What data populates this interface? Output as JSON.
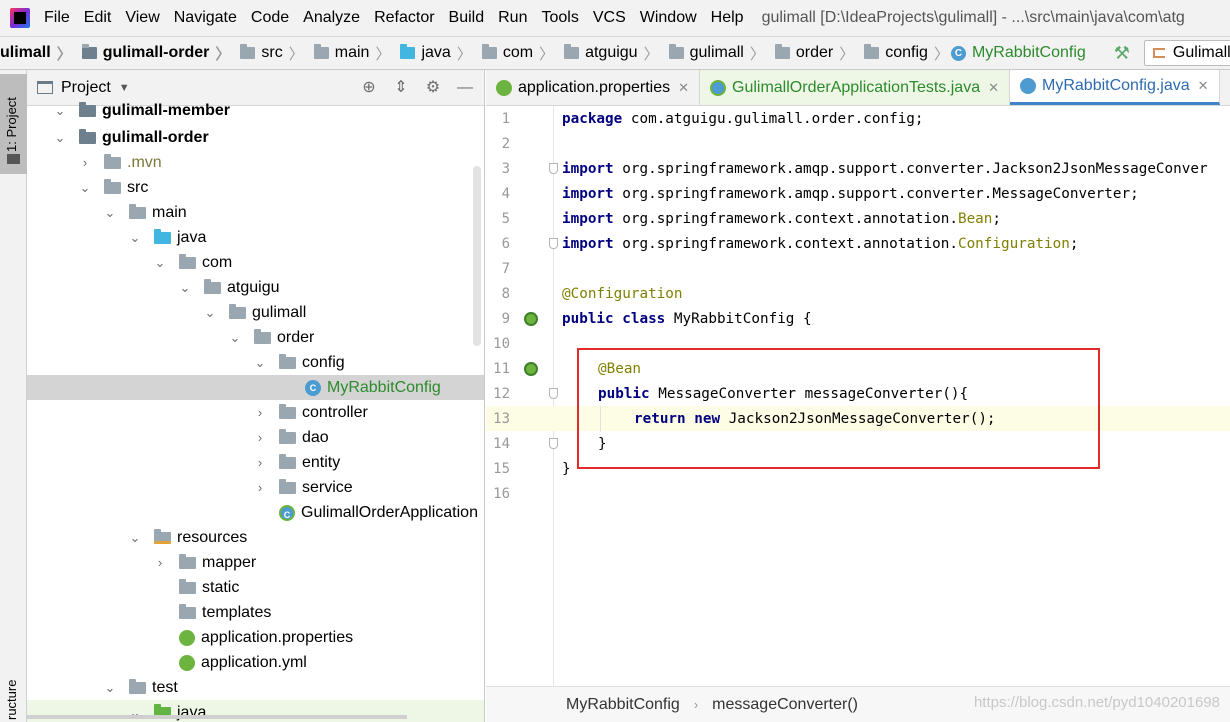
{
  "menubar": {
    "items": [
      "File",
      "Edit",
      "View",
      "Navigate",
      "Code",
      "Analyze",
      "Refactor",
      "Build",
      "Run",
      "Tools",
      "VCS",
      "Window",
      "Help"
    ],
    "window_title": "gulimall [D:\\IdeaProjects\\gulimall] - ...\\src\\main\\java\\com\\atg"
  },
  "breadcrumb": {
    "items": [
      "ulimall",
      "gulimall-order",
      "src",
      "main",
      "java",
      "com",
      "atguigu",
      "gulimall",
      "order",
      "config"
    ],
    "current_class": "MyRabbitConfig",
    "run_config": "GulimallOrderApplica"
  },
  "toolstrip": {
    "project_tab": "1: Project",
    "structure_tab": "ructure"
  },
  "project_panel": {
    "title": "Project",
    "tree": [
      {
        "label": "gulimall-member",
        "expanded": true
      },
      {
        "label": "gulimall-order",
        "expanded": true
      },
      {
        "label": ".mvn",
        "expanded": false
      },
      {
        "label": "src",
        "expanded": true
      },
      {
        "label": "main",
        "expanded": true
      },
      {
        "label": "java",
        "expanded": true
      },
      {
        "label": "com",
        "expanded": true
      },
      {
        "label": "atguigu",
        "expanded": true
      },
      {
        "label": "gulimall",
        "expanded": true
      },
      {
        "label": "order",
        "expanded": true
      },
      {
        "label": "config",
        "expanded": true
      },
      {
        "label": "MyRabbitConfig",
        "selected": true
      },
      {
        "label": "controller",
        "expanded": false
      },
      {
        "label": "dao",
        "expanded": false
      },
      {
        "label": "entity",
        "expanded": false
      },
      {
        "label": "service",
        "expanded": false
      },
      {
        "label": "GulimallOrderApplication"
      },
      {
        "label": "resources",
        "expanded": true
      },
      {
        "label": "mapper",
        "expanded": false
      },
      {
        "label": "static"
      },
      {
        "label": "templates"
      },
      {
        "label": "application.properties"
      },
      {
        "label": "application.yml"
      },
      {
        "label": "test",
        "expanded": true
      },
      {
        "label": "java",
        "expanded": true
      }
    ]
  },
  "editor": {
    "tabs": [
      {
        "label": "application.properties",
        "active": false
      },
      {
        "label": "GulimallOrderApplicationTests.java",
        "active": false
      },
      {
        "label": "MyRabbitConfig.java",
        "active": true
      }
    ],
    "line_numbers": [
      "1",
      "2",
      "3",
      "4",
      "5",
      "6",
      "7",
      "8",
      "9",
      "10",
      "11",
      "12",
      "13",
      "14",
      "15",
      "16"
    ],
    "current_line": 13,
    "code": {
      "l1_kw": "package",
      "l1_rest": " com.atguigu.gulimall.order.config;",
      "l3_kw": "import",
      "l3_rest": " org.springframework.amqp.support.converter.Jackson2JsonMessageConver",
      "l4_kw": "import",
      "l4_rest": " org.springframework.amqp.support.converter.MessageConverter;",
      "l5_kw": "import",
      "l5_rest": " org.springframework.context.annotation.",
      "l5_id": "Bean",
      "l5_end": ";",
      "l6_kw": "import",
      "l6_rest": " org.springframework.context.annotation.",
      "l6_id": "Configuration",
      "l6_end": ";",
      "l8_ann": "@Configuration",
      "l9_kw": "public class",
      "l9_rest": " MyRabbitConfig {",
      "l11_ann": "@Bean",
      "l12_kw": "public",
      "l12_rest": " MessageConverter messageConverter(){",
      "l13_kw1": "return",
      "l13_kw2": "new",
      "l13_rest": " Jackson2JsonMessageConverter();",
      "l14": "}",
      "l15": "}"
    },
    "status_breadcrumb": [
      "MyRabbitConfig",
      "messageConverter()"
    ]
  },
  "watermark": "https://blog.csdn.net/pyd1040201698"
}
